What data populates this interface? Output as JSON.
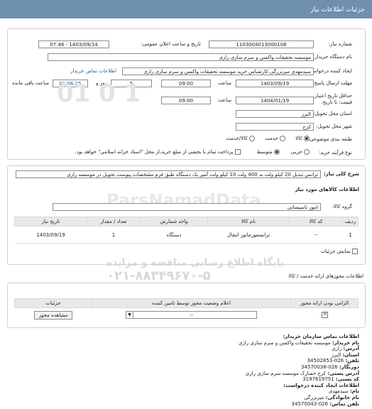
{
  "header": {
    "title": "جزئیات اطلاعات نیاز"
  },
  "form": {
    "need_number_label": "شماره نیاز:",
    "need_number": "1103004013000108",
    "announce_label": "تاریخ و ساعت اعلان عمومی:",
    "announce_value": "1403/09/14 - 07:46",
    "buyer_label": "نام دستگاه خریدار:",
    "buyer_value": "موسسه تحقیقات واکسن و سرم سازی رازی",
    "creator_label": "ایجاد کننده درخواست:",
    "creator_value": "سیدمهدی میرنزرگی کارشناس خرید موسسه تحقیقات واکسن و سرم سازی رازی",
    "buyer_contact_link": "اطلاعات تماس خریدار",
    "reply_deadline_label": "مهلت ارسال پاسخ: تا",
    "reply_date": "1403/09/19",
    "time_label": "ساعت",
    "reply_time": "09:00",
    "days_value": "5",
    "days_label": "روز و",
    "remaining_time": "01:06:25",
    "remaining_label": "ساعت باقی مانده",
    "validity_label": "حداقل تاریخ اعتبار",
    "validity_label2": "قیمت: تا تاریخ:",
    "validity_date": "1404/01/19",
    "validity_time": "09:00",
    "province_label": "استان محل تحویل:",
    "province_value": "البرز",
    "city_label": "شهر محل تحویل:",
    "city_value": "کرج",
    "category_label": "طبقه بندی موضوعی:",
    "category_options": [
      "کالا",
      "خدمت",
      "کالا/خدمت"
    ],
    "process_label": "نوع فرآیند خرید:",
    "process_options": [
      "جزیی",
      "متوسط"
    ],
    "payment_note": "پرداخت تمام یا بخشی از مبلغ خرید،از محل \"اسناد خزانه اسلامی\" خواهد بود."
  },
  "summary": {
    "label": "شرح کلی نیاز:",
    "text": "ترانس تبدیل 20 کیلو ولت به 400 ولت 10 کیلو ولت آمپر یک دستگاه طبق فرم مشخصات پیوست تحویل در موسسه رازی"
  },
  "goods": {
    "section_title": "اطلاعات کالاهای مورد نیاز",
    "group_label": "گروه کالا:",
    "group_value": "امور تاسیساتی",
    "columns": [
      "ردیف",
      "کد کالا",
      "نام کالا",
      "واحد شمارش",
      "تعداد / مقدار",
      "تاریخ نیاز"
    ],
    "rows": [
      {
        "idx": "1",
        "code": "--",
        "name": "ترانسفورماتور انتقال",
        "unit": "دستگاه",
        "qty": "1",
        "date": "1403/09/19"
      }
    ],
    "show_details_label": "نمایش جزئیات"
  },
  "permits": {
    "section_title": "اطلاعات مجوزهای ارائه خدمت / کالا",
    "columns": [
      "الزامی بودن ارائه مجوز",
      "اعلام وضعیت مجوز توسط تامین کننده",
      "جزئیات"
    ],
    "status_value": "--",
    "view_button": "مشاهده مجوز"
  },
  "contact": {
    "title": "اطلاعات تماس سازمان خریدار:",
    "buyer_name_label": "نام خریدار:",
    "buyer_name": "موسسه تحقیقات واکسن و سرم سازی رازی",
    "address_label": "آدرس:",
    "address": "رازی",
    "province_label": "استان:",
    "province": "البرز",
    "phone1_label": "تلفن:",
    "phone1": "026-34502853",
    "fax_label": "دورنگار:",
    "fax": "026-34570038",
    "address2_label": "آدرس پستی:",
    "address2": "کرج حصارک موسسه سرم سازی رازی",
    "postal_label": "کد پستی:",
    "postal": "3197619751",
    "creator_title": "اطلاعات ایجاد کننده درخواست:",
    "first_label": "نام:",
    "first": "سیدمهدی",
    "last_label": "نام خانوادگی:",
    "last": "میرنزرگی",
    "phone2_label": "تلفن تماس:",
    "phone2": "026-34570043"
  },
  "watermark": {
    "line1": "ParsNamadData",
    "line2": "پایگاه اطلاع رسانی مناقصه و مزایده",
    "line3": "۰۲۱-۸۸۳۴۹۶۷۰-۵"
  }
}
